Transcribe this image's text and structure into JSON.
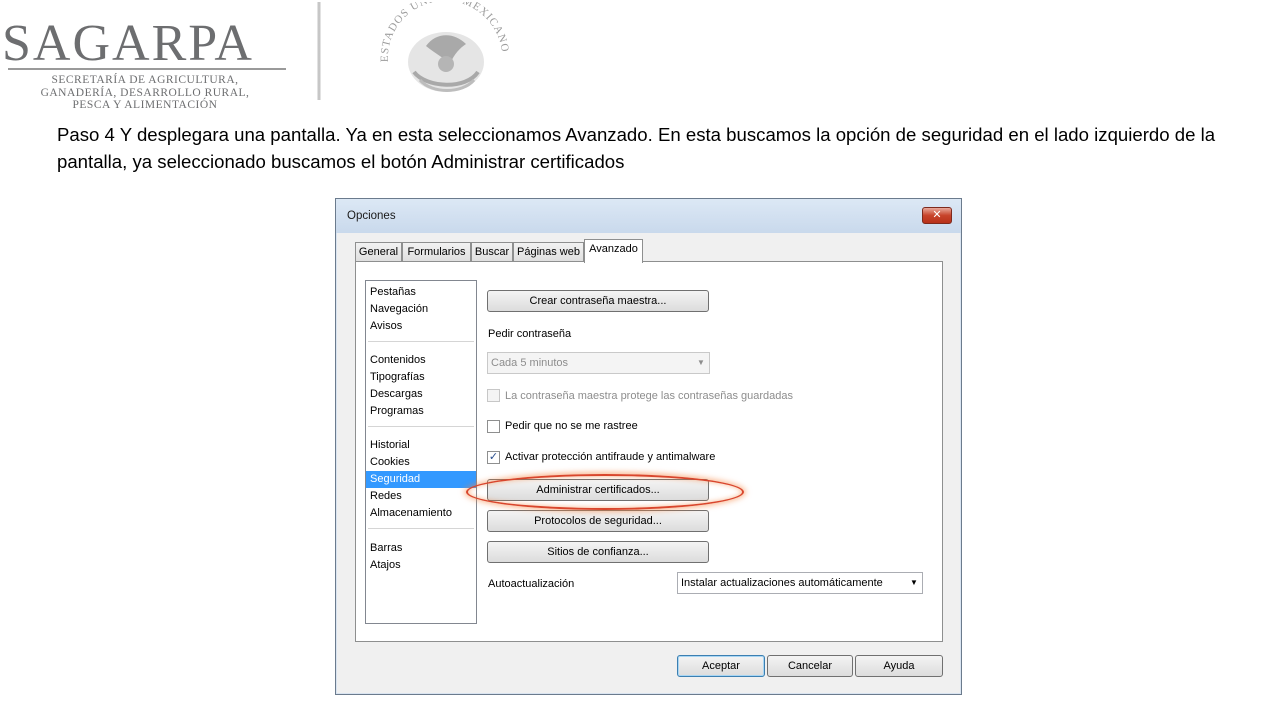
{
  "header": {
    "logo_text": "SAGARPA",
    "logo_subtitle": [
      "SECRETARÍA DE AGRICULTURA,",
      "GANADERÍA, DESARROLLO RURAL,",
      "PESCA Y ALIMENTACIÓN"
    ],
    "seal_text": "ESTADOS UNIDOS MEXICANOS"
  },
  "instruction": "Paso 4 Y desplegara una pantalla. Ya en esta seleccionamos  Avanzado. En esta buscamos la opción de seguridad en el lado izquierdo de la pantalla, ya seleccionado buscamos  el botón Administrar certificados",
  "dialog": {
    "title": "Opciones",
    "close_symbol": "✕",
    "tabs": [
      "General",
      "Formularios",
      "Buscar",
      "Páginas web",
      "Avanzado"
    ],
    "active_tab": "Avanzado",
    "categories": [
      "Pestañas",
      "Navegación",
      "Avisos",
      "Contenidos",
      "Tipografías",
      "Descargas",
      "Programas",
      "Historial",
      "Cookies",
      "Seguridad",
      "Redes",
      "Almacenamiento",
      "Barras",
      "Atajos"
    ],
    "selected_category": "Seguridad",
    "master_password_button": "Crear contraseña maestra...",
    "ask_password_label": "Pedir contraseña",
    "ask_password_value": "Cada 5 minutos",
    "checkbox_master_protect": {
      "label": "La contraseña maestra protege las contraseñas guardadas",
      "checked": false,
      "enabled": false
    },
    "checkbox_do_not_track": {
      "label": "Pedir que no se me rastree",
      "checked": false,
      "enabled": true
    },
    "checkbox_fraud_protection": {
      "label": "Activar protección antifraude y antimalware",
      "checked": true,
      "enabled": true
    },
    "manage_certificates_button": "Administrar certificados...",
    "security_protocols_button": "Protocolos de seguridad...",
    "trusted_sites_button": "Sitios de confianza...",
    "auto_update_label": "Autoactualización",
    "auto_update_value": "Instalar actualizaciones automáticamente",
    "combo_arrow": "▼",
    "check_mark": "✓",
    "footer": {
      "ok": "Aceptar",
      "cancel": "Cancelar",
      "help": "Ayuda"
    }
  },
  "colors": {
    "selection": "#3399ff",
    "highlight_ring": "#d9462c",
    "logo_gray": "#6d6e70"
  }
}
